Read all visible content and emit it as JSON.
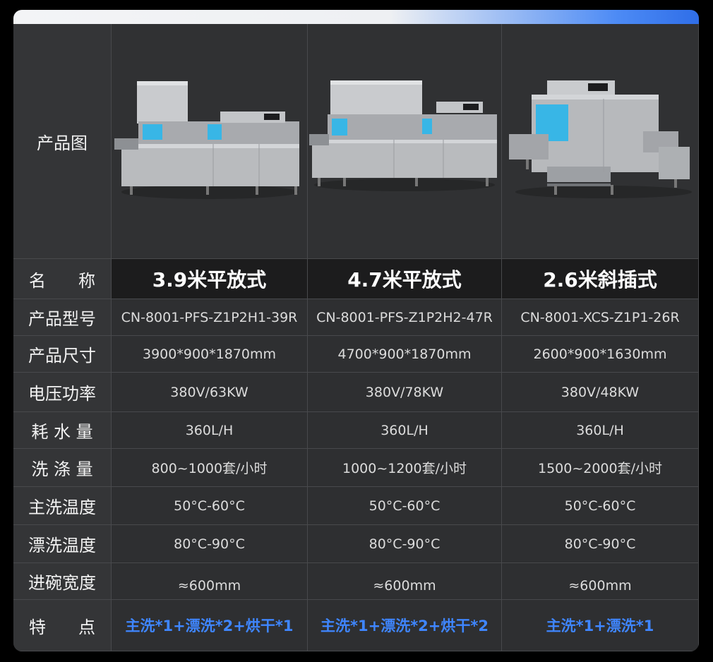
{
  "labels": {
    "image": "产品图",
    "name_a": "名",
    "name_b": "称",
    "model": "产品型号",
    "size": "产品尺寸",
    "power": "电压功率",
    "water": "耗 水 量",
    "capacity": "洗 涤 量",
    "wash_temp": "主洗温度",
    "rinse_temp": "漂洗温度",
    "width": "进碗宽度",
    "feature_a": "特",
    "feature_b": "点"
  },
  "products": [
    {
      "image_icon": "flat-conveyor-dishwasher-icon",
      "name": "3.9米平放式",
      "model": "CN-8001-PFS-Z1P2H1-39R",
      "size": "3900*900*1870mm",
      "power": "380V/63KW",
      "water": "360L/H",
      "capacity": "800~1000套/小时",
      "wash_temp": "50°C-60°C",
      "rinse_temp": "80°C-90°C",
      "width": "≈600mm",
      "feature": "主洗*1+漂洗*2+烘干*1"
    },
    {
      "image_icon": "flat-conveyor-dishwasher-long-icon",
      "name": "4.7米平放式",
      "model": "CN-8001-PFS-Z1P2H2-47R",
      "size": "4700*900*1870mm",
      "power": "380V/78KW",
      "water": "360L/H",
      "capacity": "1000~1200套/小时",
      "wash_temp": "50°C-60°C",
      "rinse_temp": "80°C-90°C",
      "width": "≈600mm",
      "feature": "主洗*1+漂洗*2+烘干*2"
    },
    {
      "image_icon": "inclined-rack-dishwasher-icon",
      "name": "2.6米斜插式",
      "model": "CN-8001-XCS-Z1P1-26R",
      "size": "2600*900*1630mm",
      "power": "380V/48KW",
      "water": "360L/H",
      "capacity": "1500~2000套/小时",
      "wash_temp": "50°C-60°C",
      "rinse_temp": "80°C-90°C",
      "width": "≈600mm",
      "feature": "主洗*1+漂洗*1"
    }
  ],
  "colors": {
    "card_bg": "#2e2f31",
    "name_row_bg": "#1c1c1d",
    "feature_text": "#3f86ff",
    "accent_gradient_end": "#2f6ee8"
  }
}
